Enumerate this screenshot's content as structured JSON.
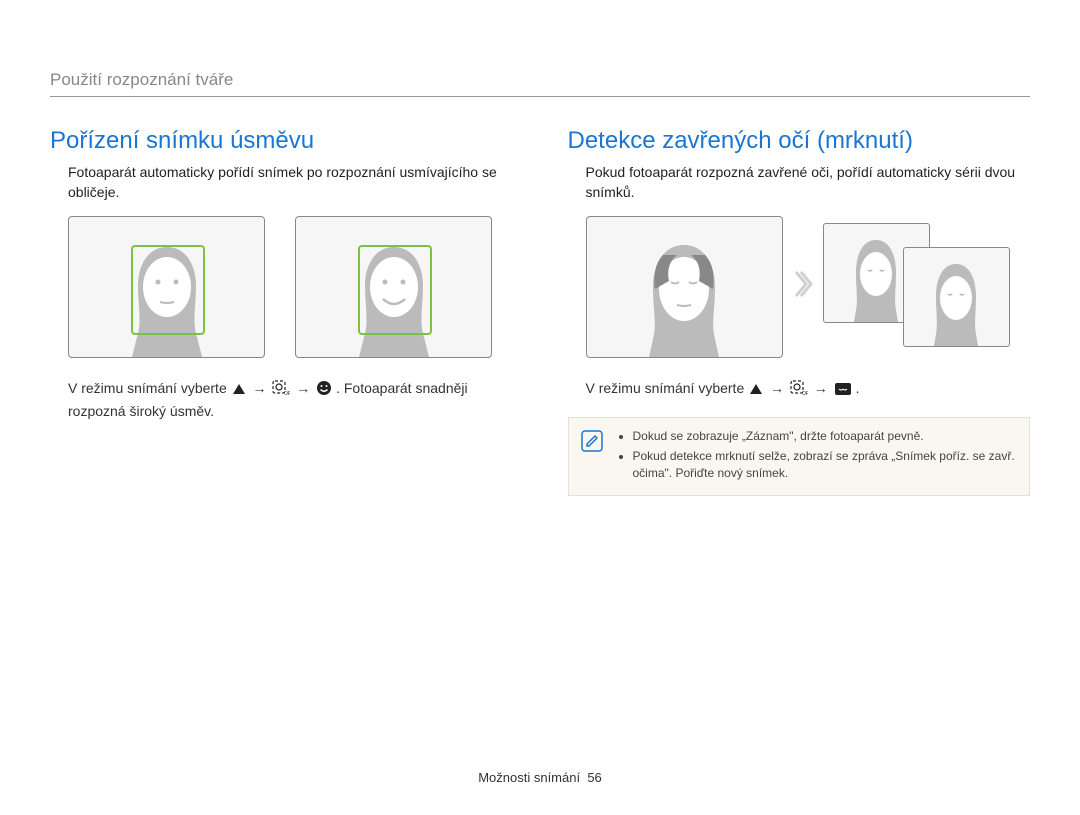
{
  "breadcrumb": "Použití rozpoznání tváře",
  "left": {
    "title": "Pořízení snímku úsměvu",
    "desc": "Fotoaparát automaticky pořídí snímek po rozpoznání usmívajícího se obličeje.",
    "instr_prefix": "V režimu snímání vyberte ",
    "instr_suffix": ". Fotoaparát snadněji rozpozná široký úsměv.",
    "arrow": "→"
  },
  "right": {
    "title": "Detekce zavřených očí (mrknutí)",
    "desc": "Pokud fotoaparát rozpozná zavřené oči, pořídí automaticky sérii dvou snímků.",
    "instr_prefix": "V režimu snímání vyberte ",
    "instr_suffix": ".",
    "arrow": "→",
    "notes": [
      "Dokud se zobrazuje „Záznam\", držte fotoaparát pevně.",
      "Pokud detekce mrknutí selže, zobrazí se zpráva „Snímek poříz. se zavř. očima\". Pořiďte nový snímek."
    ]
  },
  "footer": {
    "section": "Možnosti snímání",
    "page": "56"
  },
  "icons": {
    "up_triangle": "up-triangle-icon",
    "face_off": "face-detect-off-icon",
    "smile": "smile-face-icon",
    "blink": "blink-detect-icon",
    "note": "note-pencil-icon"
  }
}
